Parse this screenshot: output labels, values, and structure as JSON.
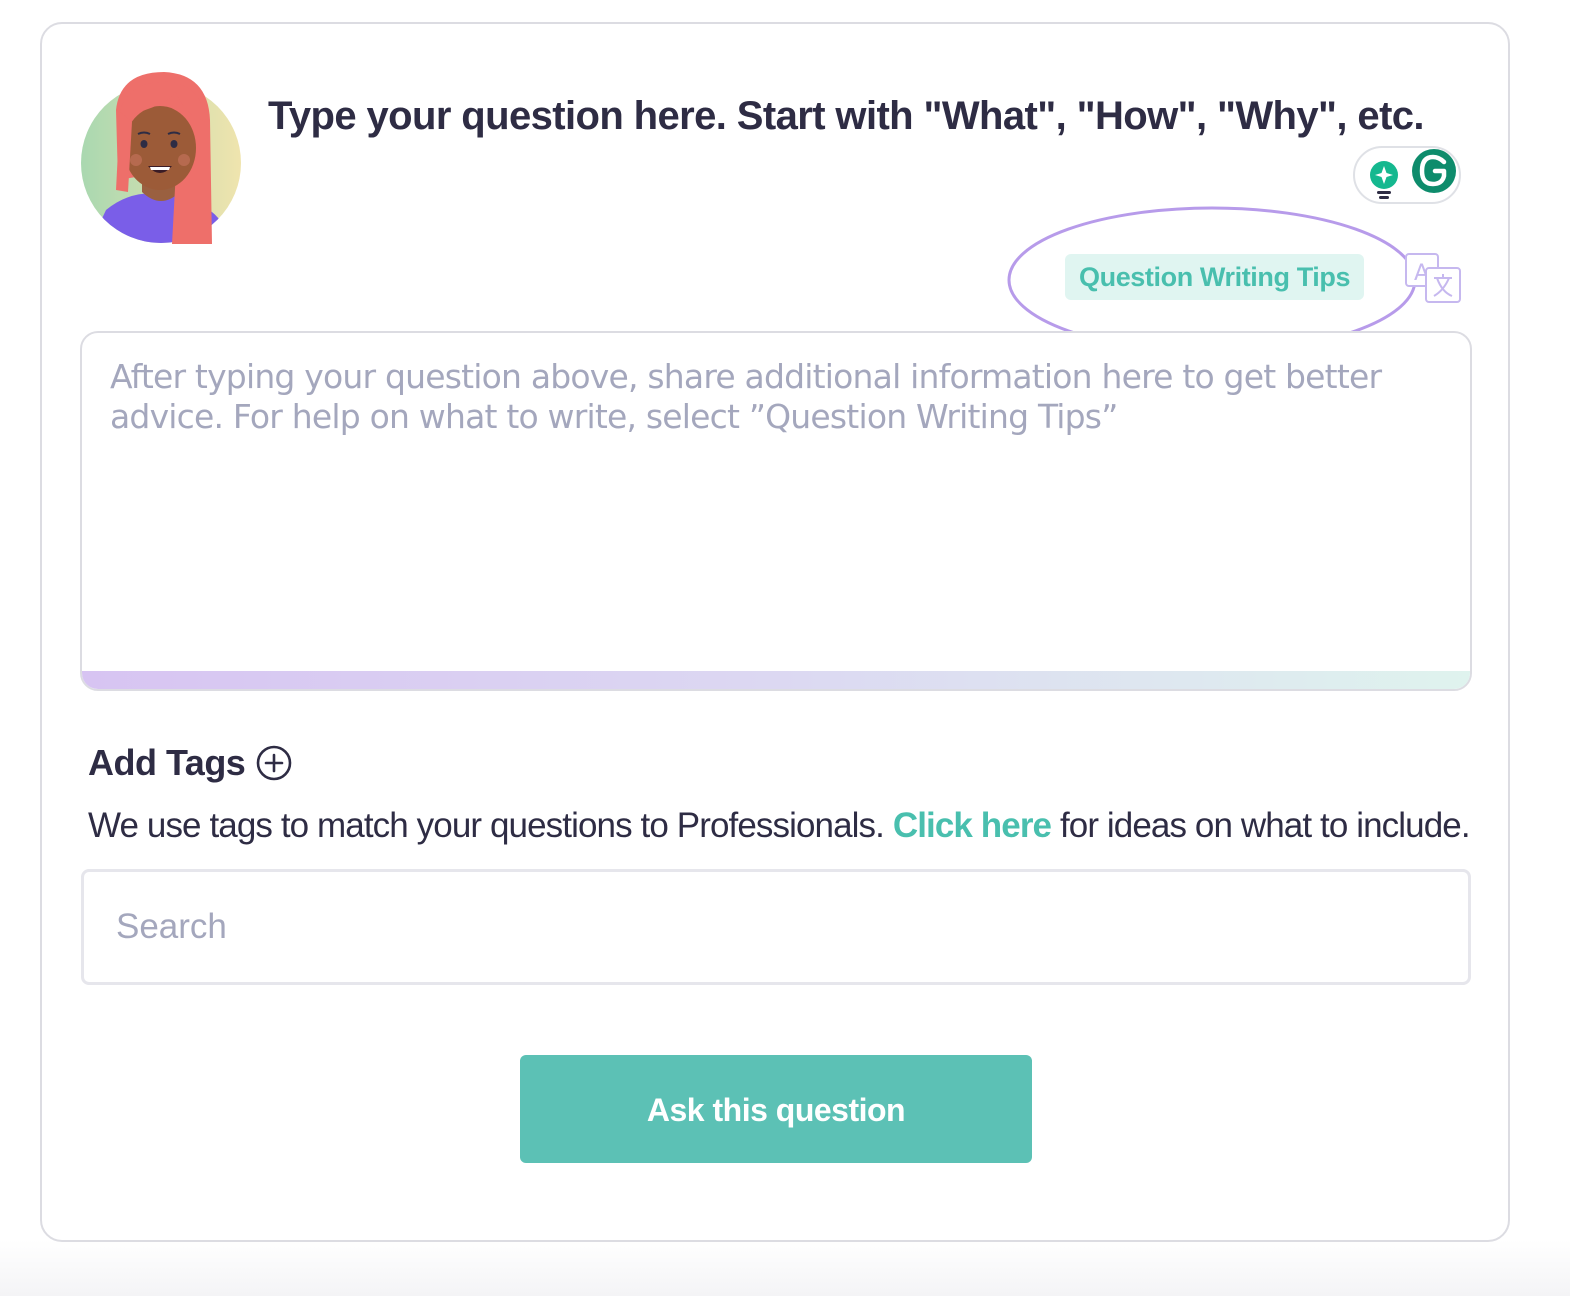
{
  "question": {
    "title": "Type your question here. Start with \"What\", \"How\", \"Why\", etc."
  },
  "toolbar": {
    "tips_label": "Question Writing Tips",
    "grammarly_icon": "grammarly-g-icon",
    "suggestion_icon": "lightbulb-icon",
    "translate_icon": "translate-icon"
  },
  "details": {
    "placeholder": "After typing your question above, share additional information here to get better advice. For help on what to write, select ”Question Writing Tips”"
  },
  "tags": {
    "heading": "Add Tags",
    "description_prefix": "We use tags to match your questions to Professionals. ",
    "link_label": "Click here",
    "description_suffix": " for ideas on what to include.",
    "search_placeholder": "Search",
    "search_value": ""
  },
  "submit": {
    "label": "Ask this question"
  },
  "colors": {
    "accent": "#49bfae",
    "button": "#5cc1b5",
    "text": "#2e2c44",
    "placeholder": "#a4a7bd",
    "highlight_ring": "#b79bea"
  }
}
